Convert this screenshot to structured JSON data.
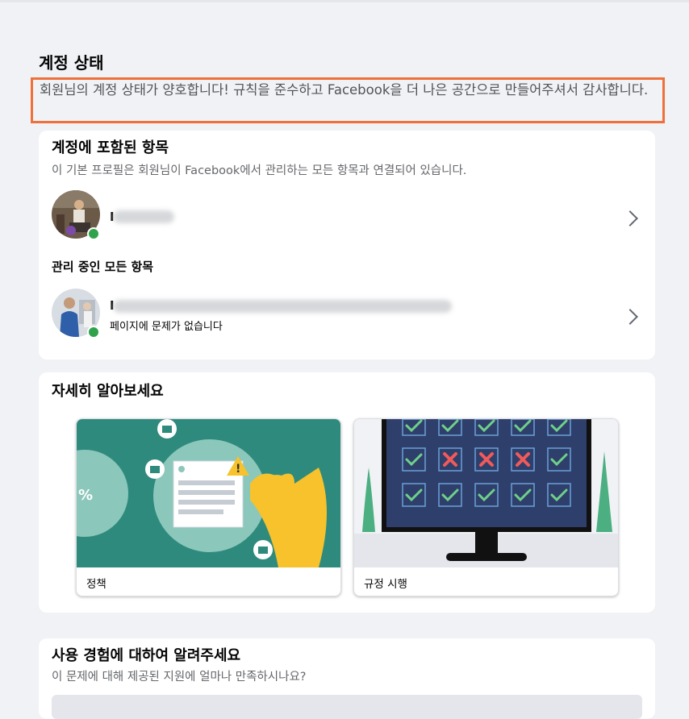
{
  "header": {
    "title": "계정 상태",
    "status_message": "회원님의 계정 상태가 양호합니다! 규칙을 준수하고 Facebook을 더 나은 공간으로 만들어주셔서 감사합니다."
  },
  "included": {
    "title": "계정에 포함된 항목",
    "subtitle": "이 기본 프로필은 회원님이 Facebook에서 관리하는 모든 항목과 연결되어 있습니다.",
    "profile_initial": "I",
    "managed_label": "관리 중인 모든 항목",
    "page_initial": "I",
    "page_status": "페이지에 문제가 없습니다"
  },
  "learn_more": {
    "title": "자세히 알아보세요",
    "tiles": [
      {
        "label": "정책",
        "icon": "policy-illustration"
      },
      {
        "label": "규정 시행",
        "icon": "enforcement-illustration"
      }
    ]
  },
  "feedback": {
    "title": "사용 경험에 대하여 알려주세요",
    "subtitle": "이 문제에 대해 제공된 지원에 얼마나 만족하시나요?"
  },
  "colors": {
    "highlight_border": "#f0703c",
    "online": "#31a24c",
    "policy_teal": "#2f8a7e",
    "screen_navy": "#2f3f6b"
  }
}
